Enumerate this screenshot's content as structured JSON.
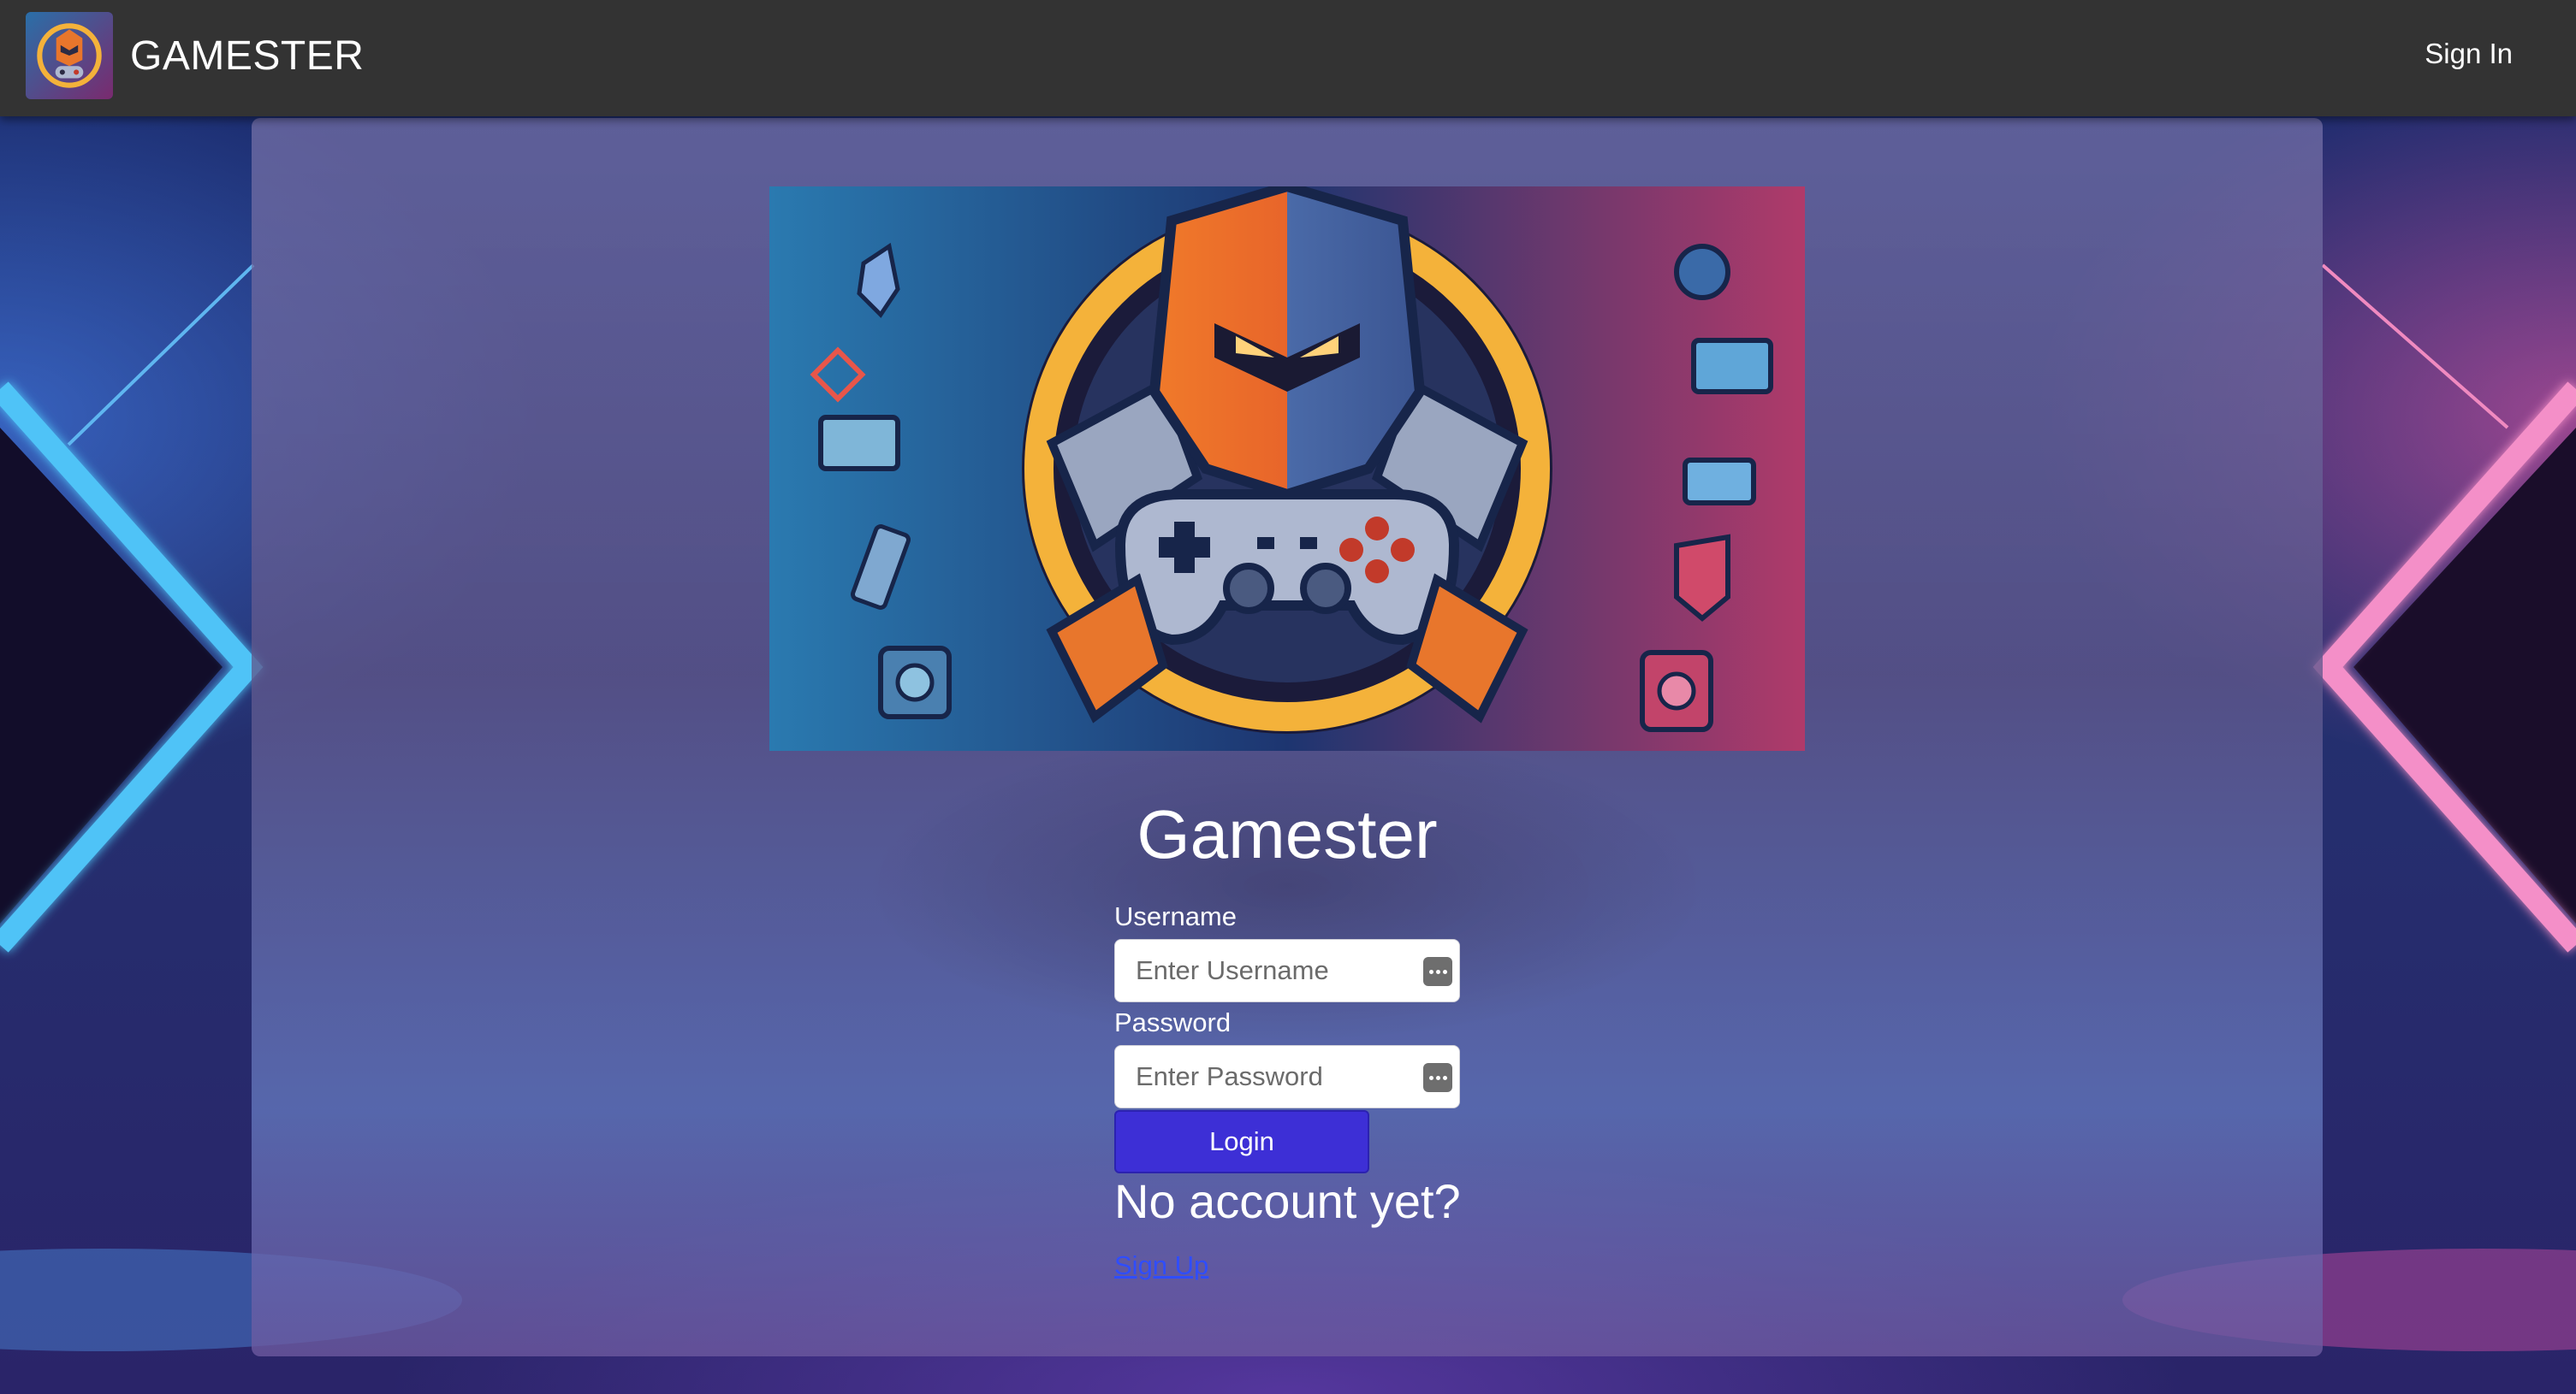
{
  "header": {
    "brand_name": "GAMESTER",
    "signin_label": "Sign In"
  },
  "main": {
    "title": "Gamester",
    "username_label": "Username",
    "username_placeholder": "Enter Username",
    "password_label": "Password",
    "password_placeholder": "Enter Password",
    "login_label": "Login",
    "no_account_text": "No account yet?",
    "signup_label": "Sign Up"
  },
  "icons": {
    "brand_logo": "gamester-logo-icon",
    "hero": "gaming-robot-controller-illustration",
    "password_manager": "password-manager-icon"
  },
  "colors": {
    "header_bg": "#333333",
    "login_button_bg": "#3d2fd6",
    "link": "#2f4dff",
    "neon_blue": "#4fc3f7",
    "neon_pink": "#f48fc8"
  }
}
